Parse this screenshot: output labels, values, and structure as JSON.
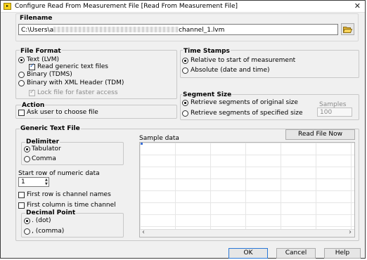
{
  "window": {
    "title": "Configure Read From Measurement File [Read From Measurement File]",
    "close_glyph": "✕"
  },
  "filename": {
    "label": "Filename",
    "value_prefix": "C:\\Users\\a",
    "value_suffix": "channel_1.lvm",
    "browse_icon": "folder-open-icon"
  },
  "file_format": {
    "label": "File Format",
    "options": [
      {
        "label": "Text (LVM)",
        "selected": true
      },
      {
        "label": "Binary (TDMS)",
        "selected": false
      },
      {
        "label": "Binary with XML Header (TDM)",
        "selected": false
      }
    ],
    "read_generic": {
      "label": "Read generic text files",
      "checked": true
    },
    "lock_file": {
      "label": "Lock file for faster access",
      "checked": true
    }
  },
  "time_stamps": {
    "label": "Time Stamps",
    "options": [
      {
        "label": "Relative to start of measurement",
        "selected": true
      },
      {
        "label": "Absolute (date and time)",
        "selected": false
      }
    ]
  },
  "segment_size": {
    "label": "Segment Size",
    "options": [
      {
        "label": "Retrieve segments of original size",
        "selected": true
      },
      {
        "label": "Retrieve segments of specified size",
        "selected": false
      }
    ],
    "samples_label": "Samples",
    "samples_value": "100"
  },
  "action": {
    "label": "Action",
    "ask_user": {
      "label": "Ask user to choose file",
      "checked": false
    }
  },
  "generic_text": {
    "label": "Generic Text File",
    "delimiter": {
      "label": "Delimiter",
      "options": [
        {
          "label": "Tabulator",
          "selected": true
        },
        {
          "label": "Comma",
          "selected": false
        }
      ]
    },
    "start_row_label": "Start row of numeric data",
    "start_row_value": "1",
    "first_row_names": {
      "label": "First row is channel names",
      "checked": false
    },
    "first_col_time": {
      "label": "First column is time channel",
      "checked": false
    },
    "decimal_point": {
      "label": "Decimal Point",
      "options": [
        {
          "label": ". (dot)",
          "selected": true
        },
        {
          "label": ", (comma)",
          "selected": false
        }
      ]
    }
  },
  "sample_data": {
    "label": "Sample data",
    "read_button": "Read File Now",
    "scroll_left": "‹",
    "scroll_right": "›"
  },
  "footer": {
    "ok": "OK",
    "cancel": "Cancel",
    "help": "Help"
  }
}
